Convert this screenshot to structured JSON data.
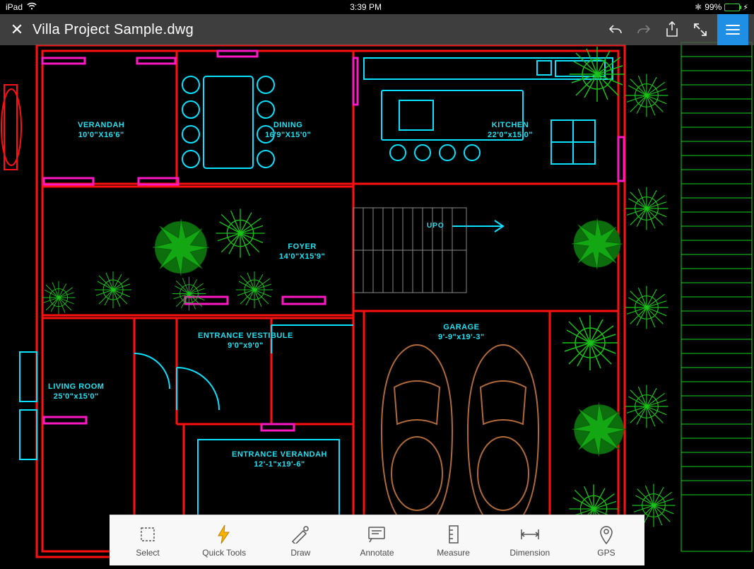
{
  "statusbar": {
    "device": "iPad",
    "time": "3:39 PM",
    "battery_percent": "99%"
  },
  "header": {
    "title": "Villa Project Sample.dwg"
  },
  "rooms": {
    "verandah": {
      "name": "VERANDAH",
      "dim": "10'0\"X16'6\""
    },
    "dining": {
      "name": "DINING",
      "dim": "16'9\"X15'0\""
    },
    "kitchen": {
      "name": "KITCHEN",
      "dim": "22'0\"x15'0\""
    },
    "foyer": {
      "name": "FOYER",
      "dim": "14'0\"X15'9\""
    },
    "vestibule": {
      "name": "ENTRANCE VESTIBULE",
      "dim": "9'0\"x9'0\""
    },
    "living": {
      "name": "LIVING ROOM",
      "dim": "25'0\"x15'0\""
    },
    "ent_ver": {
      "name": "ENTRANCE VERANDAH",
      "dim": "12'-1\"x19'-6\""
    },
    "garage": {
      "name": "GARAGE",
      "dim": "9'-9\"x19'-3\""
    }
  },
  "stair_label": "UPO",
  "toolbar": {
    "select": "Select",
    "quick": "Quick Tools",
    "draw": "Draw",
    "annotate": "Annotate",
    "measure": "Measure",
    "dimension": "Dimension",
    "gps": "GPS"
  }
}
